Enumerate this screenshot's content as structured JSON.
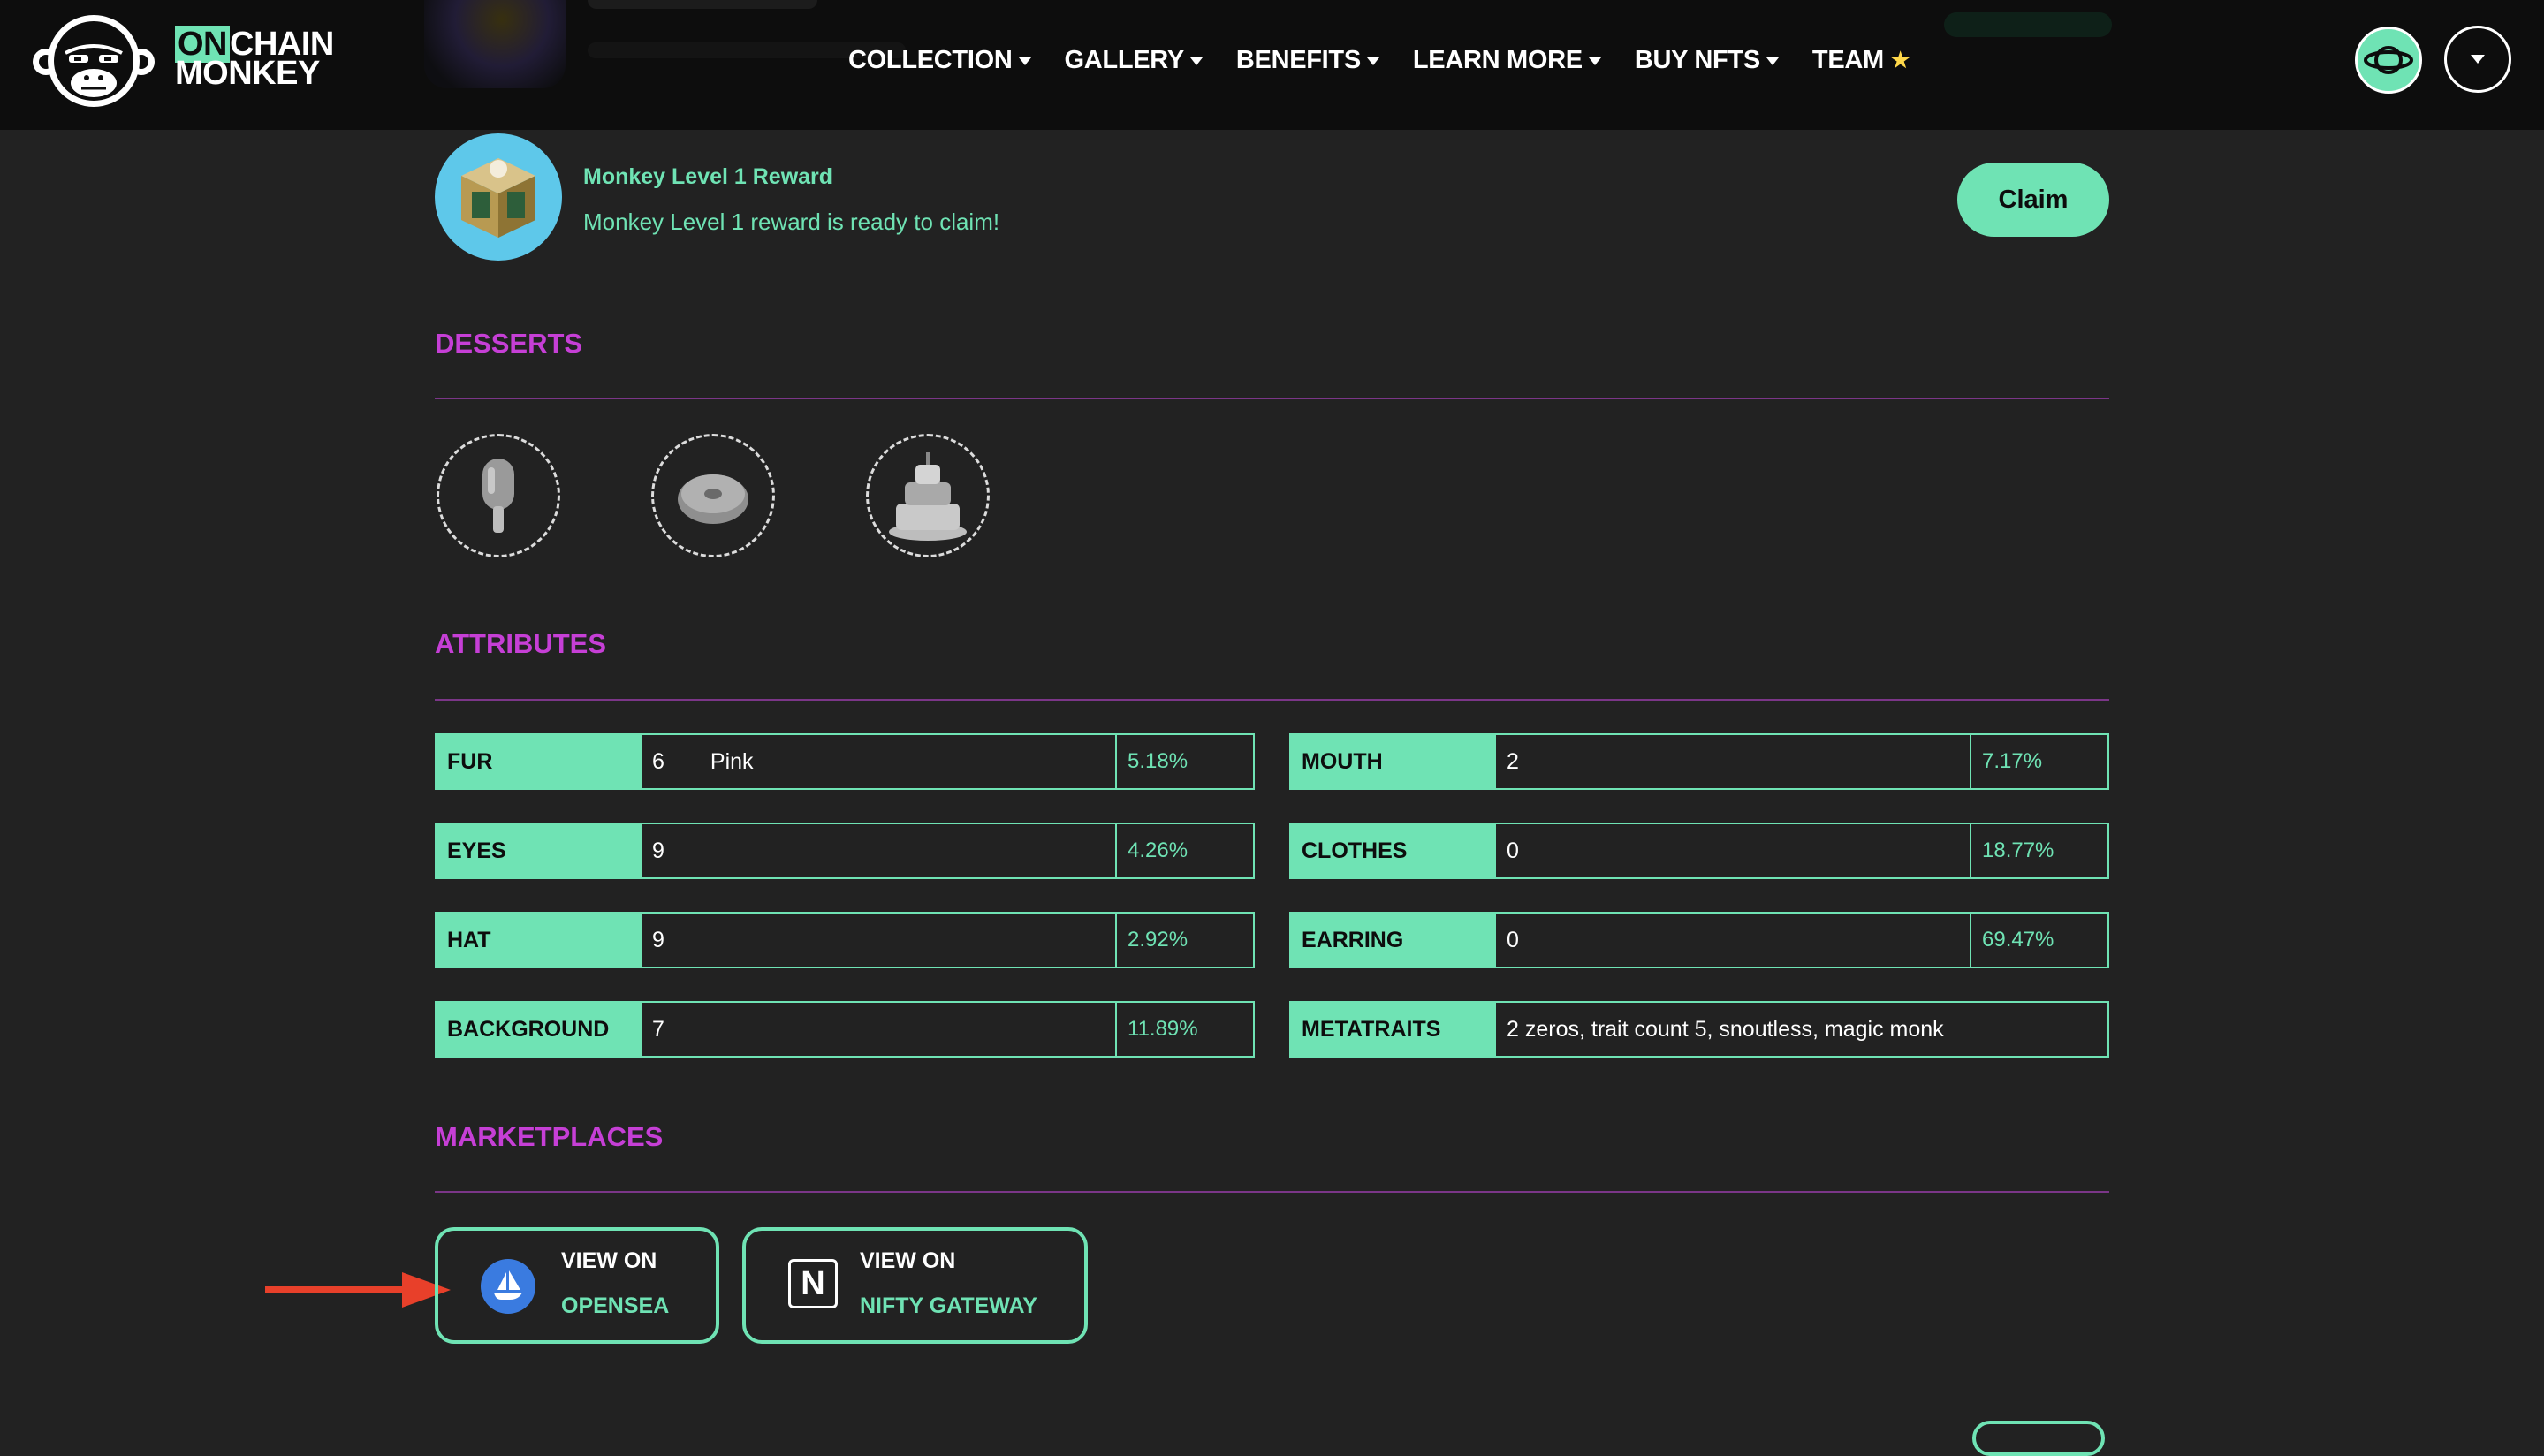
{
  "header": {
    "logo": {
      "line1_highlight": "ON",
      "line1_rest": "CHAIN",
      "line2": "MONKEY"
    },
    "nav": [
      {
        "label": "COLLECTION",
        "icon": "chevron-down-icon"
      },
      {
        "label": "GALLERY",
        "icon": "chevron-down-icon"
      },
      {
        "label": "BENEFITS",
        "icon": "chevron-down-icon"
      },
      {
        "label": "LEARN MORE",
        "icon": "chevron-down-icon"
      },
      {
        "label": "BUY NFTS",
        "icon": "chevron-down-icon"
      },
      {
        "label": "TEAM",
        "icon": "star-icon"
      }
    ],
    "right_icons": [
      "planet-icon",
      "chevron-down-icon"
    ]
  },
  "reward": {
    "title": "Monkey Level 1 Reward",
    "message": "Monkey Level 1 reward is ready to claim!",
    "claim_label": "Claim"
  },
  "desserts": {
    "title": "DESSERTS",
    "items": [
      "popsicle-icon",
      "donut-icon",
      "cake-icon"
    ]
  },
  "attributes": {
    "title": "ATTRIBUTES",
    "left": [
      {
        "label": "FUR",
        "value": "6",
        "name": "Pink",
        "pct": "5.18%"
      },
      {
        "label": "EYES",
        "value": "9",
        "pct": "4.26%"
      },
      {
        "label": "HAT",
        "value": "9",
        "pct": "2.92%"
      },
      {
        "label": "BACKGROUND",
        "value": "7",
        "pct": "11.89%"
      }
    ],
    "right": [
      {
        "label": "MOUTH",
        "value": "2",
        "pct": "7.17%"
      },
      {
        "label": "CLOTHES",
        "value": "0",
        "pct": "18.77%"
      },
      {
        "label": "EARRING",
        "value": "0",
        "pct": "69.47%"
      },
      {
        "label": "METATRAITS",
        "value": "2 zeros, trait count 5, snoutless, magic monk"
      }
    ]
  },
  "marketplaces": {
    "title": "MARKETPLACES",
    "opensea": {
      "line1": "VIEW ON",
      "line2": "OPENSEA"
    },
    "nifty": {
      "line1": "VIEW ON",
      "line2": "NIFTY GATEWAY",
      "icon_letter": "N"
    }
  },
  "colors": {
    "accent": "#6fe3b4",
    "section_title": "#c63fd6",
    "background": "#222222",
    "header_bg": "#0d0d0d",
    "annotation_arrow": "#e8402a"
  }
}
